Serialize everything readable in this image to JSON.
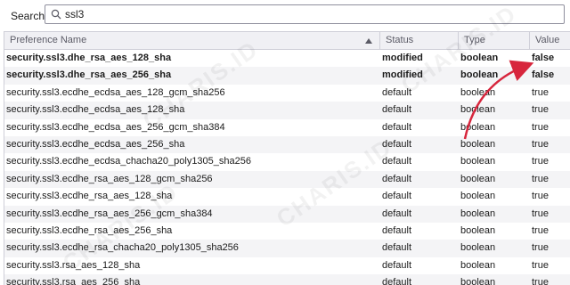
{
  "search": {
    "label": "Search:",
    "value": "ssl3",
    "icon": "search-icon"
  },
  "columns": {
    "name": "Preference Name",
    "status": "Status",
    "type": "Type",
    "value": "Value"
  },
  "rows": [
    {
      "name": "security.ssl3.dhe_rsa_aes_128_sha",
      "status": "modified",
      "type": "boolean",
      "value": "false",
      "modified": true
    },
    {
      "name": "security.ssl3.dhe_rsa_aes_256_sha",
      "status": "modified",
      "type": "boolean",
      "value": "false",
      "modified": true
    },
    {
      "name": "security.ssl3.ecdhe_ecdsa_aes_128_gcm_sha256",
      "status": "default",
      "type": "boolean",
      "value": "true",
      "modified": false
    },
    {
      "name": "security.ssl3.ecdhe_ecdsa_aes_128_sha",
      "status": "default",
      "type": "boolean",
      "value": "true",
      "modified": false
    },
    {
      "name": "security.ssl3.ecdhe_ecdsa_aes_256_gcm_sha384",
      "status": "default",
      "type": "boolean",
      "value": "true",
      "modified": false
    },
    {
      "name": "security.ssl3.ecdhe_ecdsa_aes_256_sha",
      "status": "default",
      "type": "boolean",
      "value": "true",
      "modified": false
    },
    {
      "name": "security.ssl3.ecdhe_ecdsa_chacha20_poly1305_sha256",
      "status": "default",
      "type": "boolean",
      "value": "true",
      "modified": false
    },
    {
      "name": "security.ssl3.ecdhe_rsa_aes_128_gcm_sha256",
      "status": "default",
      "type": "boolean",
      "value": "true",
      "modified": false
    },
    {
      "name": "security.ssl3.ecdhe_rsa_aes_128_sha",
      "status": "default",
      "type": "boolean",
      "value": "true",
      "modified": false
    },
    {
      "name": "security.ssl3.ecdhe_rsa_aes_256_gcm_sha384",
      "status": "default",
      "type": "boolean",
      "value": "true",
      "modified": false
    },
    {
      "name": "security.ssl3.ecdhe_rsa_aes_256_sha",
      "status": "default",
      "type": "boolean",
      "value": "true",
      "modified": false
    },
    {
      "name": "security.ssl3.ecdhe_rsa_chacha20_poly1305_sha256",
      "status": "default",
      "type": "boolean",
      "value": "true",
      "modified": false
    },
    {
      "name": "security.ssl3.rsa_aes_128_sha",
      "status": "default",
      "type": "boolean",
      "value": "true",
      "modified": false
    },
    {
      "name": "security.ssl3.rsa_aes_256_sha",
      "status": "default",
      "type": "boolean",
      "value": "true",
      "modified": false
    }
  ],
  "watermark": "CHARIS.ID",
  "colors": {
    "arrow": "#d7263d",
    "header_bg": "#f0f0f4",
    "row_alt_bg": "#f4f4f6",
    "border": "#cfcfd8"
  }
}
